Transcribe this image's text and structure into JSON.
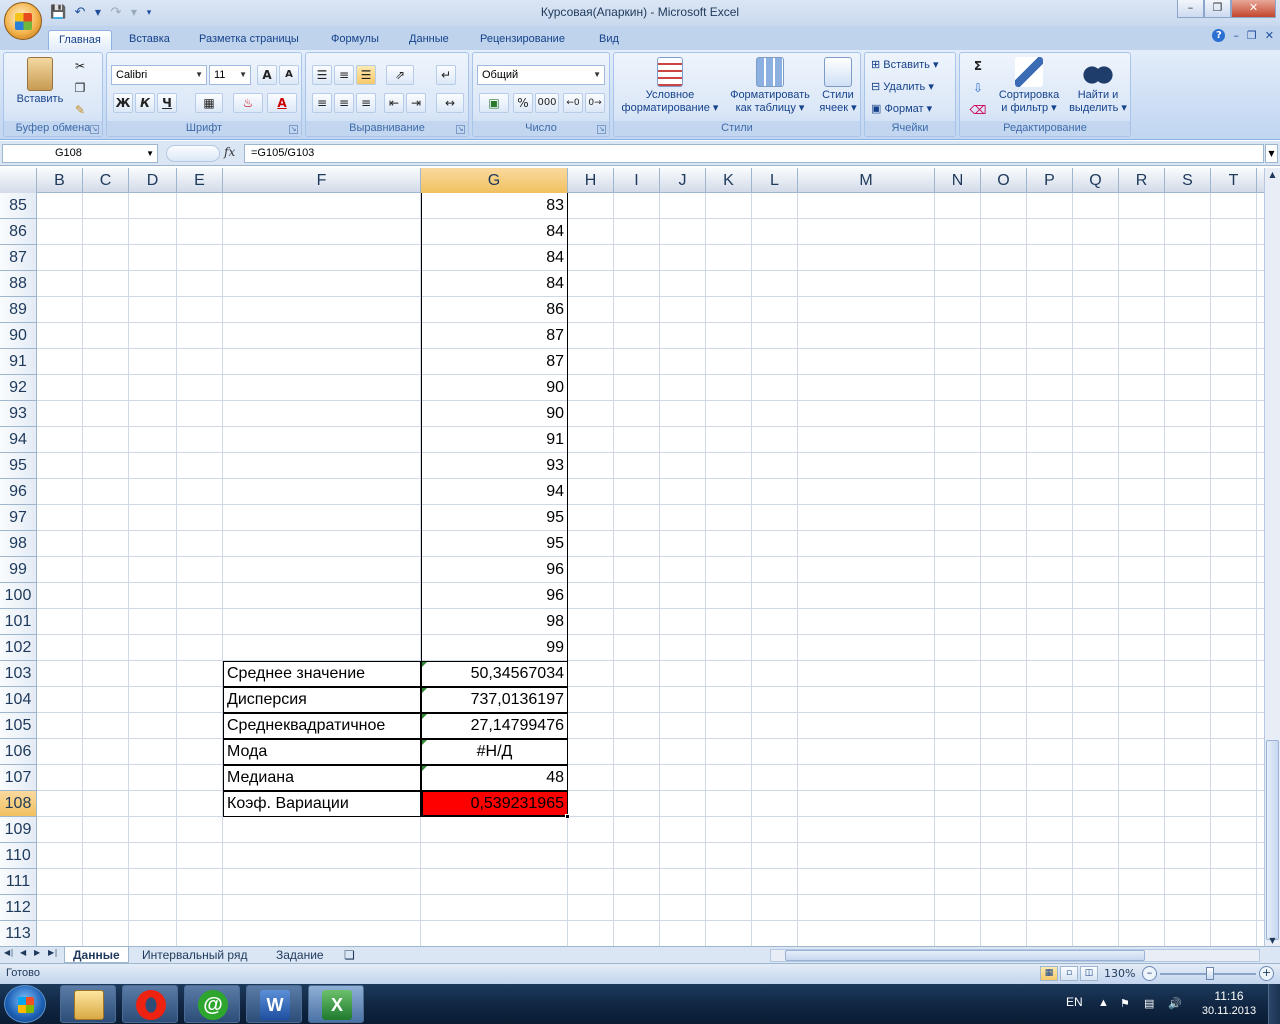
{
  "window": {
    "title": "Курсовая(Апаркин)  -  Microsoft Excel"
  },
  "ribbon_tabs": [
    "Главная",
    "Вставка",
    "Разметка страницы",
    "Формулы",
    "Данные",
    "Рецензирование",
    "Вид"
  ],
  "ribbon": {
    "clipboard": {
      "label": "Буфер обмена",
      "paste": "Вставить"
    },
    "font": {
      "label": "Шрифт",
      "font_name": "Calibri",
      "font_size": "11",
      "bold": "Ж",
      "italic": "К",
      "underline": "Ч"
    },
    "alignment": {
      "label": "Выравнивание"
    },
    "number": {
      "label": "Число",
      "format": "Общий",
      "percent": "%",
      "thousands": "000"
    },
    "styles": {
      "label": "Стили",
      "conditional_line1": "Условное",
      "conditional_line2": "форматирование",
      "table_line1": "Форматировать",
      "table_line2": "как таблицу",
      "cell_line1": "Стили",
      "cell_line2": "ячеек"
    },
    "cells": {
      "label": "Ячейки",
      "insert": "Вставить",
      "delete": "Удалить",
      "format": "Формат"
    },
    "editing": {
      "label": "Редактирование",
      "sort_line1": "Сортировка",
      "sort_line2": "и фильтр",
      "find_line1": "Найти и",
      "find_line2": "выделить"
    }
  },
  "formula_bar": {
    "name_box": "G108",
    "fx": "fx",
    "formula": "=G105/G103"
  },
  "grid": {
    "columns": [
      "B",
      "C",
      "D",
      "E",
      "F",
      "G",
      "H",
      "I",
      "J",
      "K",
      "L",
      "M",
      "N",
      "O",
      "P",
      "Q",
      "R",
      "S",
      "T"
    ],
    "selected_column": "G",
    "rows": [
      "85",
      "86",
      "87",
      "88",
      "89",
      "90",
      "91",
      "92",
      "93",
      "94",
      "95",
      "96",
      "97",
      "98",
      "99",
      "100",
      "101",
      "102",
      "103",
      "104",
      "105",
      "106",
      "107",
      "108",
      "109",
      "110",
      "111",
      "112",
      "113"
    ],
    "selected_row": "108",
    "g_values": [
      "83",
      "84",
      "84",
      "84",
      "86",
      "87",
      "87",
      "90",
      "90",
      "91",
      "93",
      "94",
      "95",
      "95",
      "96",
      "96",
      "98",
      "99"
    ],
    "stats": [
      {
        "label": "Среднее значение",
        "value": "50,34567034"
      },
      {
        "label": "Дисперсия",
        "value": "737,0136197"
      },
      {
        "label": "Среднеквадратичное",
        "value": "27,14799476"
      },
      {
        "label": "Мода",
        "value": "#Н/Д"
      },
      {
        "label": "Медиана",
        "value": "48"
      },
      {
        "label": "Коэф. Вариации",
        "value": "0,539231965"
      }
    ],
    "highlight_color": "#ff0000"
  },
  "sheet_tabs": [
    "Данные",
    "Интервальный ряд",
    "Задание"
  ],
  "active_sheet": "Данные",
  "status": {
    "text": "Готово",
    "zoom": "130%"
  },
  "taskbar": {
    "apps": [
      "explorer-icon",
      "opera-icon",
      "mail-agent-icon",
      "word-icon",
      "excel-icon"
    ],
    "lang": "EN",
    "time": "11:16",
    "date": "30.11.2013"
  }
}
